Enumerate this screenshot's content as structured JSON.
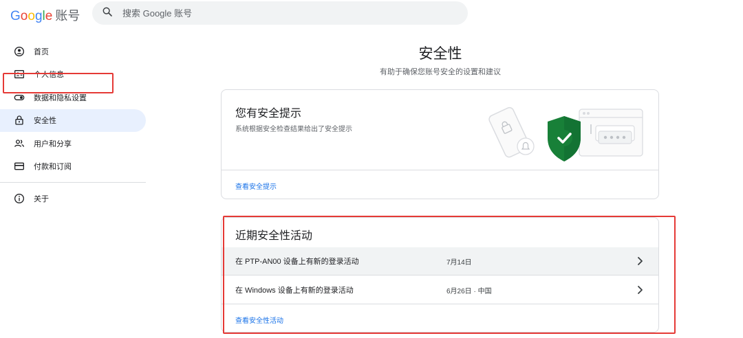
{
  "header": {
    "logo_letters": [
      "G",
      "o",
      "o",
      "g",
      "l",
      "e"
    ],
    "logo_suffix": "账号",
    "search_placeholder": "搜索 Google 账号"
  },
  "sidebar": {
    "items": [
      {
        "label": "首页",
        "icon": "account-circle-icon"
      },
      {
        "label": "个人信息",
        "icon": "id-card-icon"
      },
      {
        "label": "数据和隐私设置",
        "icon": "toggle-icon"
      },
      {
        "label": "安全性",
        "icon": "lock-icon",
        "active": true
      },
      {
        "label": "用户和分享",
        "icon": "people-icon"
      },
      {
        "label": "付款和订阅",
        "icon": "credit-card-icon"
      }
    ],
    "footer_items": [
      {
        "label": "关于",
        "icon": "info-icon"
      }
    ]
  },
  "main": {
    "title": "安全性",
    "subtitle": "有助于确保您账号安全的设置和建议",
    "tips_card": {
      "title": "您有安全提示",
      "description": "系统根据安全检查结果给出了安全提示",
      "link": "查看安全提示"
    },
    "activity_card": {
      "title": "近期安全性活动",
      "rows": [
        {
          "text": "在 PTP-AN00 设备上有新的登录活动",
          "date": "7月14日"
        },
        {
          "text": "在 Windows 设备上有新的登录活动",
          "date": "6月26日 · 中国"
        }
      ],
      "link": "查看安全性活动"
    }
  },
  "colors": {
    "accent_blue": "#1a73e8",
    "active_nav_bg": "#e8f0fe",
    "highlight_red": "#e53935",
    "shield_green": "#188038"
  }
}
